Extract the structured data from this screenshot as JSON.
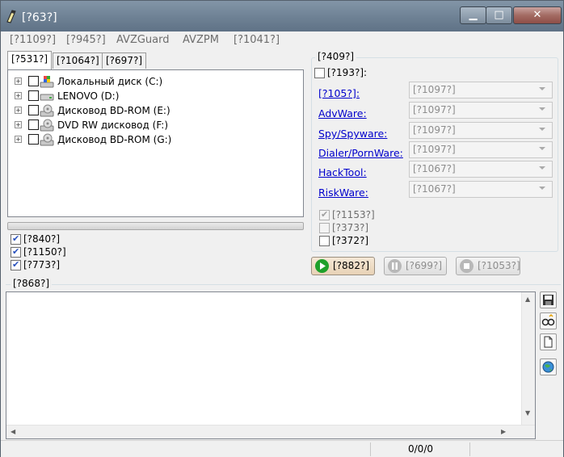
{
  "window": {
    "title": "[?63?]"
  },
  "menu": [
    "[?1109?]",
    "[?945?]",
    "AVZGuard",
    "AVZPM",
    "[?1041?]"
  ],
  "tabs": [
    "[?531?]",
    "[?1064?]",
    "[?697?]"
  ],
  "drives": [
    {
      "label": "Локальный диск (C:)",
      "icon": "hard-disk-windows-icon"
    },
    {
      "label": "LENOVO (D:)",
      "icon": "hard-disk-icon"
    },
    {
      "label": "Дисковод BD-ROM (E:)",
      "icon": "optical-drive-icon"
    },
    {
      "label": "DVD RW дисковод (F:)",
      "icon": "optical-drive-icon"
    },
    {
      "label": "Дисковод BD-ROM (G:)",
      "icon": "optical-drive-icon"
    }
  ],
  "scan_options": [
    {
      "label": "[?840?]",
      "checked": true
    },
    {
      "label": "[?1150?]",
      "checked": true
    },
    {
      "label": "[?773?]",
      "checked": true
    }
  ],
  "methods": {
    "title": "[?409?]",
    "detect_label": "[?193?]:",
    "rows": [
      {
        "label": "[?105?]:",
        "value": "[?1097?]"
      },
      {
        "label": "AdvWare:",
        "value": "[?1097?]"
      },
      {
        "label": "Spy/Spyware:",
        "value": "[?1097?]"
      },
      {
        "label": "Dialer/PornWare:",
        "value": "[?1097?]"
      },
      {
        "label": "HackTool:",
        "value": "[?1067?]"
      },
      {
        "label": "RiskWare:",
        "value": "[?1067?]"
      }
    ],
    "options": [
      {
        "label": "[?1153?]",
        "checked": true,
        "disabled": true
      },
      {
        "label": "[?373?]",
        "checked": false,
        "disabled": true
      },
      {
        "label": "[?372?]",
        "checked": false,
        "disabled": false
      }
    ]
  },
  "actions": {
    "start": "[?882?]",
    "pause": "[?699?]",
    "stop": "[?1053?]"
  },
  "log": {
    "title": "[?868?]"
  },
  "status": {
    "count": "0/0/0"
  },
  "colors": {
    "link": "#0000cc",
    "titlebar": "#6e8194",
    "start_icon": "#1fa02a"
  }
}
